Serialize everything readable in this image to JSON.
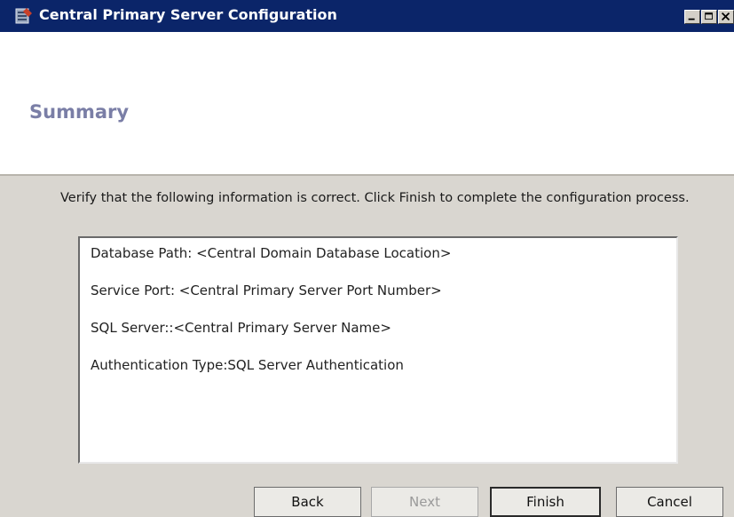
{
  "window": {
    "title": "Central Primary Server Configuration"
  },
  "header": {
    "title": "Summary"
  },
  "content": {
    "instructions": "Verify that the following information is correct. Click Finish to complete the configuration process.",
    "summary_lines": [
      "Database Path: <Central Domain Database Location>",
      "Service Port: <Central Primary Server Port Number>",
      "SQL Server::<Central Primary Server Name>",
      "Authentication Type:SQL Server Authentication"
    ]
  },
  "buttons": {
    "back": "Back",
    "next": "Next",
    "finish": "Finish",
    "cancel": "Cancel"
  },
  "colors": {
    "titlebar": "#0b2569",
    "header_title": "#7a7ea6",
    "content_bg": "#d9d6d0"
  },
  "icons": {
    "app": "server-app-icon",
    "minimize": "minimize-icon",
    "maximize": "maximize-icon",
    "close": "close-icon"
  }
}
